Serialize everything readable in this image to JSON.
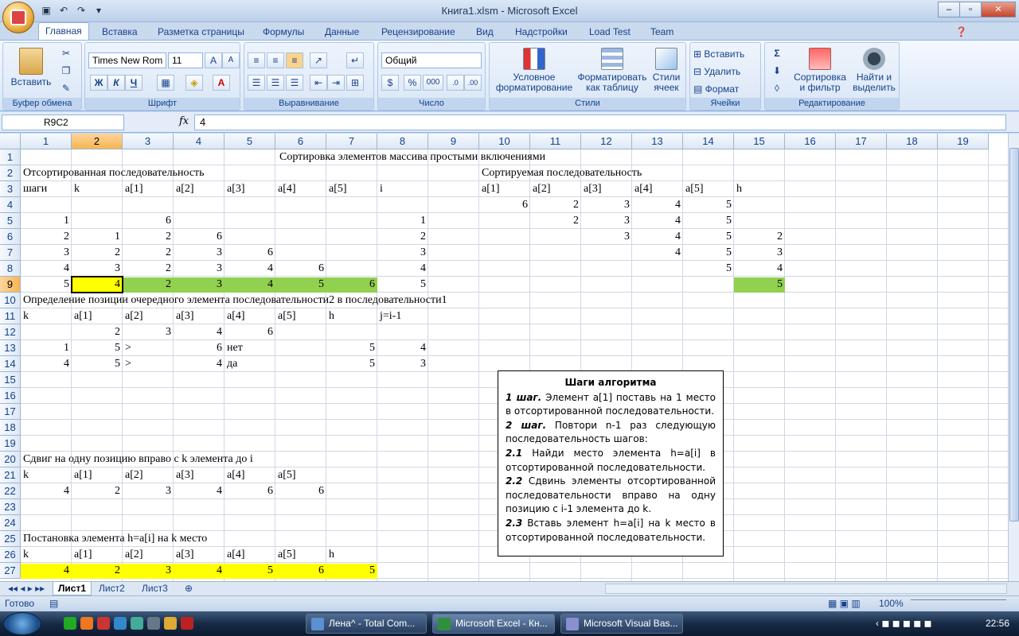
{
  "window": {
    "title": "Книга1.xlsm - Microsoft Excel",
    "min": "–",
    "max": "▫",
    "close": "✕"
  },
  "tabs": [
    "Главная",
    "Вставка",
    "Разметка страницы",
    "Формулы",
    "Данные",
    "Рецензирование",
    "Вид",
    "Надстройки",
    "Load Test",
    "Team"
  ],
  "ribbon": {
    "clipboard": {
      "label": "Буфер обмена",
      "paste": "Вставить"
    },
    "font": {
      "label": "Шрифт",
      "name": "Times New Rom",
      "size": "11",
      "bold": "Ж",
      "italic": "К",
      "underline": "Ч"
    },
    "alignment": {
      "label": "Выравнивание"
    },
    "number": {
      "label": "Число",
      "format": "Общий",
      "percent": "%",
      "thousands": "000"
    },
    "styles": {
      "label": "Стили",
      "cond": "Условное форматирование",
      "table": "Форматировать как таблицу",
      "cellstyles": "Стили ячеек"
    },
    "cells": {
      "label": "Ячейки",
      "insert": "Вставить",
      "delete": "Удалить",
      "format": "Формат"
    },
    "editing": {
      "label": "Редактирование",
      "sort": "Сортировка и фильтр",
      "find": "Найти и выделить",
      "sigma": "Σ"
    }
  },
  "formula": {
    "namebox": "R9C2",
    "fx": "fx",
    "value": "4"
  },
  "columns": [
    "1",
    "2",
    "3",
    "4",
    "5",
    "6",
    "7",
    "8",
    "9",
    "10",
    "11",
    "12",
    "13",
    "14",
    "15",
    "16",
    "17",
    "18",
    "19"
  ],
  "rows": [
    "1",
    "2",
    "3",
    "4",
    "5",
    "6",
    "7",
    "8",
    "9",
    "10",
    "11",
    "12",
    "13",
    "14",
    "15",
    "16",
    "17",
    "18",
    "19",
    "20",
    "21",
    "22",
    "23",
    "24",
    "25",
    "26",
    "27"
  ],
  "cells": {
    "r1": "Сортировка элементов массива простыми включениями",
    "r2a": "Отсортированная последовательность",
    "r2b": "Сортируемая последовательность",
    "r3": [
      "шаги",
      "k",
      "a[1]",
      "a[2]",
      "a[3]",
      "a[4]",
      "a[5]",
      "i"
    ],
    "r3b": [
      "a[1]",
      "a[2]",
      "a[3]",
      "a[4]",
      "a[5]",
      "h"
    ],
    "r4": [
      "6",
      "2",
      "3",
      "4",
      "5"
    ],
    "r5": [
      "1",
      "6",
      "1",
      "2",
      "3",
      "4",
      "5"
    ],
    "r6": [
      "2",
      "1",
      "2",
      "6",
      "2",
      "3",
      "4",
      "5",
      "2"
    ],
    "r7": [
      "3",
      "2",
      "2",
      "3",
      "6",
      "3",
      "4",
      "5",
      "3"
    ],
    "r8": [
      "4",
      "3",
      "2",
      "3",
      "4",
      "6",
      "4",
      "5",
      "4"
    ],
    "r9": [
      "5",
      "4",
      "2",
      "3",
      "4",
      "5",
      "6",
      "5",
      "5"
    ],
    "r10": "Определение позиции очередного элемента последовательности2 в последовательности1",
    "r11": [
      "k",
      "a[1]",
      "a[2]",
      "a[3]",
      "a[4]",
      "a[5]",
      "h",
      "j=i-1"
    ],
    "r12": [
      "2",
      "3",
      "4",
      "6"
    ],
    "r13": [
      "1",
      "5",
      ">",
      "6",
      "нет",
      "5",
      "4"
    ],
    "r14": [
      "4",
      "5",
      ">",
      "4",
      "да",
      "5",
      "3"
    ],
    "r20": "Сдвиг на одну позицию вправо с k элемента до i",
    "r21": [
      "k",
      "a[1]",
      "a[2]",
      "a[3]",
      "a[4]",
      "a[5]"
    ],
    "r22": [
      "4",
      "2",
      "3",
      "4",
      "6",
      "6"
    ],
    "r25": "Постановка элемента h=a[i] на k место",
    "r26": [
      "k",
      "a[1]",
      "a[2]",
      "a[3]",
      "a[4]",
      "a[5]",
      "h"
    ],
    "r27": [
      "4",
      "2",
      "3",
      "4",
      "5",
      "6",
      "5"
    ]
  },
  "textbox": {
    "title": "Шаги алгоритма",
    "s1b": "1 шаг.",
    "s1": " Элемент  a[1] поставь на 1 место в отсортированной последовательности.",
    "s2b": "2 шаг.",
    "s2": " Повтори n-1 раз следующую последовательность шагов:",
    "s21b": "2.1",
    "s21": " Найди место элемента h=a[i] в отсортированной последовательности.",
    "s22b": "2.2",
    "s22": " Сдвинь элементы отсортированной последовательности вправо на одну позицию с i-1 элемента до k.",
    "s23b": "2.3",
    "s23": " Вставь элемент h=a[i] на k место в отсортированной последовательности."
  },
  "sheets": [
    "Лист1",
    "Лист2",
    "Лист3"
  ],
  "status": {
    "ready": "Готово",
    "zoom": "100%"
  },
  "taskbar": {
    "btn1": "Лена^ - Total Com...",
    "btn2": "Microsoft Excel - Кн...",
    "btn3": "Microsoft Visual Bas...",
    "clock": "22:56"
  },
  "colors": {
    "yellow": "#ffff00",
    "green": "#92d050",
    "accent": "#15428b"
  }
}
